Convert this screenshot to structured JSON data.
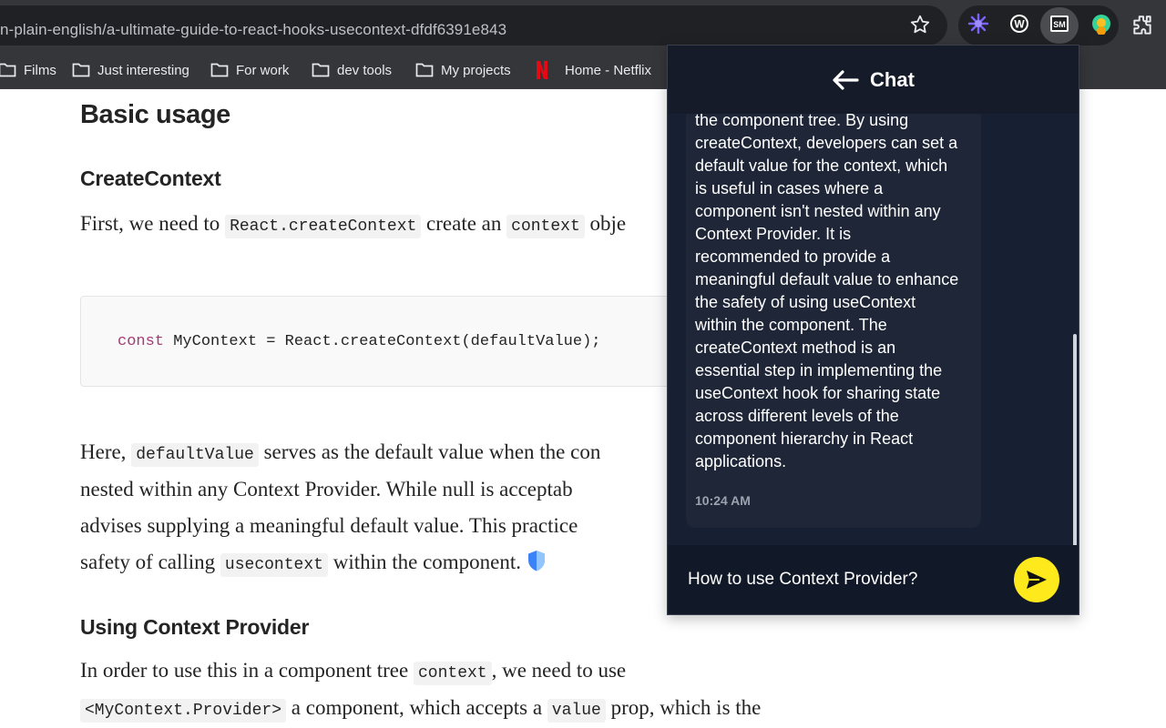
{
  "browser": {
    "url": "n-plain-english/a-ultimate-guide-to-react-hooks-usecontext-dfdf6391e843",
    "bookmarks": [
      "Films",
      "Just interesting",
      "For work",
      "dev tools",
      "My projects",
      "Home - Netflix"
    ],
    "extension_icons": [
      "perplexity-icon",
      "wordtune-icon",
      "sm-extension-icon",
      "avatar-extension-icon",
      "extensions-puzzle-icon"
    ]
  },
  "article": {
    "heading_basic": "Basic usage",
    "heading_create": "CreateContext",
    "p1": {
      "t1": "First, we need to ",
      "c1": "React.createContext",
      "t2": " create an ",
      "c2": "context",
      "t3": " obje"
    },
    "code": {
      "kw": "const",
      "rest": " MyContext = React.createContext(defaultValue);"
    },
    "p2": {
      "t0": "Here, ",
      "c1": "defaultValue",
      "t1": " serves as the default value when the con",
      "l2": "nested within any Context Provider. While null is acceptab",
      "l3": "advises supplying a meaningful default value. This practice",
      "l4a": "safety of calling ",
      "c2": "usecontext",
      "l4b": " within the component."
    },
    "heading_provider": "Using Context Provider",
    "p3": {
      "t1": "In order to use this in a component tree ",
      "c1": "context",
      "t2": ", we need to use",
      "c2": "<MyContext.Provider>",
      "t3": " a component, which accepts a ",
      "c3": "value",
      "t4": " prop, which is the"
    }
  },
  "chat": {
    "title": "Chat",
    "message": "passing props through each level of\nthe component tree. By using\ncreateContext, developers can set a\ndefault value for the context, which\nis useful in cases where a\ncomponent isn't nested within any\nContext Provider. It is\nrecommended to provide a\nmeaningful default value to enhance\nthe safety of using useContext\nwithin the component. The\ncreateContext method is an\nessential step in implementing the\nuseContext hook for sharing state\nacross different levels of the\ncomponent hierarchy in React\napplications.",
    "time": "10:24 AM",
    "input_value": "How to use Context Provider?",
    "accent_color": "#fde91c"
  }
}
